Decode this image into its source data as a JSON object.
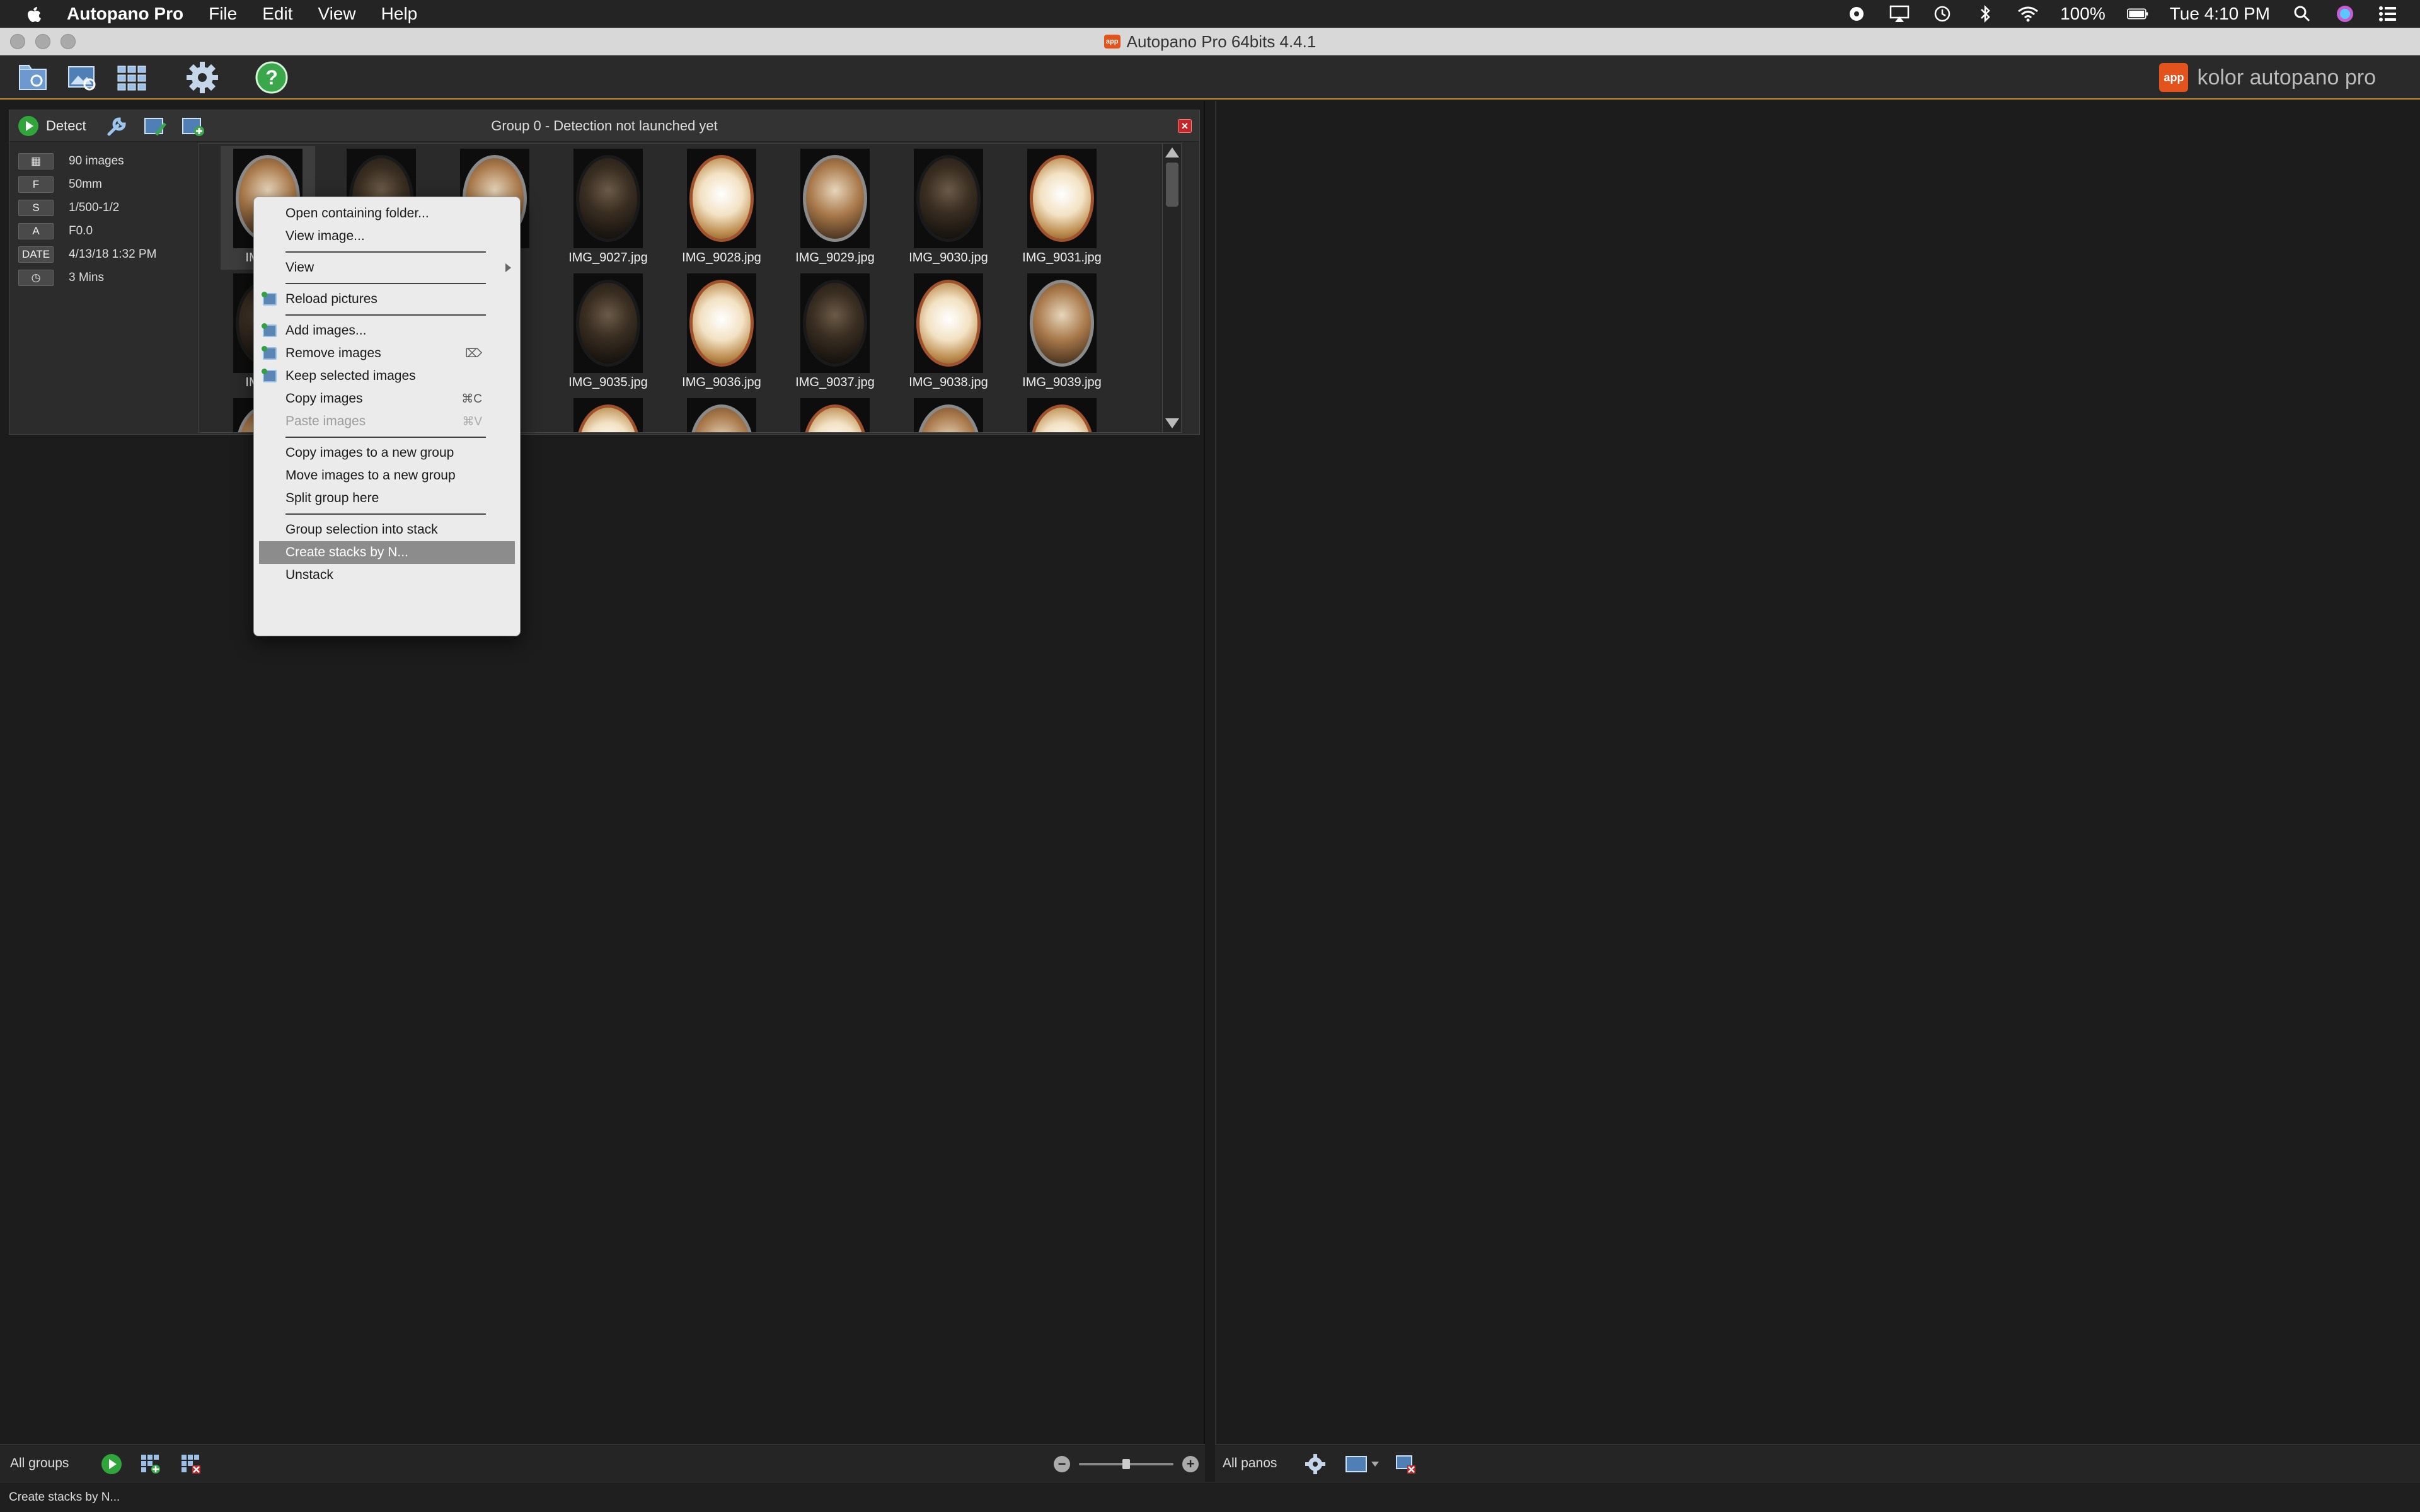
{
  "menubar": {
    "app_name": "Autopano Pro",
    "items": [
      "File",
      "Edit",
      "View",
      "Help"
    ],
    "battery": "100%",
    "clock": "Tue 4:10 PM"
  },
  "window": {
    "title": "Autopano Pro 64bits 4.4.1",
    "app_badge": "app"
  },
  "brand": {
    "logo": "app",
    "name": "kolor autopano pro"
  },
  "group": {
    "detect_label": "Detect",
    "title": "Group 0 - Detection not launched yet",
    "close": "×",
    "info": [
      {
        "key": "▦",
        "value": "90 images"
      },
      {
        "key": "F",
        "value": "50mm"
      },
      {
        "key": "S",
        "value": "1/500-1/2"
      },
      {
        "key": "A",
        "value": "F0.0"
      },
      {
        "key": "DATE",
        "value": "4/13/18 1:32 PM"
      },
      {
        "key": "◷",
        "value": "3 Mins"
      }
    ],
    "thumbnails": [
      {
        "name": "IMG_90",
        "tone": "mid"
      },
      {
        "name": "",
        "tone": "dark"
      },
      {
        "name": "",
        "tone": "mid"
      },
      {
        "name": "IMG_9027.jpg",
        "tone": "dark"
      },
      {
        "name": "IMG_9028.jpg",
        "tone": "bright"
      },
      {
        "name": "IMG_9029.jpg",
        "tone": "mid"
      },
      {
        "name": "IMG_9030.jpg",
        "tone": "dark"
      },
      {
        "name": "IMG_9031.jpg",
        "tone": "bright"
      },
      {
        "name": "IMG_90",
        "tone": "dark"
      },
      {
        "name": "IMG_9035.jpg",
        "tone": "dark"
      },
      {
        "name": "IMG_9036.jpg",
        "tone": "bright"
      },
      {
        "name": "IMG_9037.jpg",
        "tone": "dark"
      },
      {
        "name": "IMG_9038.jpg",
        "tone": "bright"
      },
      {
        "name": "IMG_9039.jpg",
        "tone": "mid"
      }
    ]
  },
  "context_menu": {
    "items": [
      {
        "type": "item",
        "label": "Open containing folder..."
      },
      {
        "type": "item",
        "label": "View image..."
      },
      {
        "type": "sep"
      },
      {
        "type": "item",
        "label": "View",
        "submenu": true
      },
      {
        "type": "sep"
      },
      {
        "type": "item",
        "label": "Reload pictures",
        "icon": "reload-pictures-icon"
      },
      {
        "type": "sep"
      },
      {
        "type": "item",
        "label": "Add images...",
        "icon": "add-images-icon"
      },
      {
        "type": "item",
        "label": "Remove images",
        "icon": "remove-images-icon",
        "shortcut": "⌦"
      },
      {
        "type": "item",
        "label": "Keep selected images",
        "icon": "keep-images-icon"
      },
      {
        "type": "item",
        "label": "Copy images",
        "shortcut": "⌘C"
      },
      {
        "type": "item",
        "label": "Paste images",
        "shortcut": "⌘V",
        "disabled": true
      },
      {
        "type": "sep"
      },
      {
        "type": "item",
        "label": "Copy images to a new group"
      },
      {
        "type": "item",
        "label": "Move images to a new group"
      },
      {
        "type": "item",
        "label": "Split group here"
      },
      {
        "type": "sep"
      },
      {
        "type": "item",
        "label": "Group selection into stack"
      },
      {
        "type": "item",
        "label": "Create stacks by N...",
        "highlighted": true
      },
      {
        "type": "item",
        "label": "Unstack"
      }
    ]
  },
  "bottom": {
    "left_label": "All groups",
    "right_label": "All panos",
    "zoom_minus": "−",
    "zoom_plus": "+",
    "zoom_level": 0.5
  },
  "statusbar": {
    "text": "Create stacks by N..."
  }
}
